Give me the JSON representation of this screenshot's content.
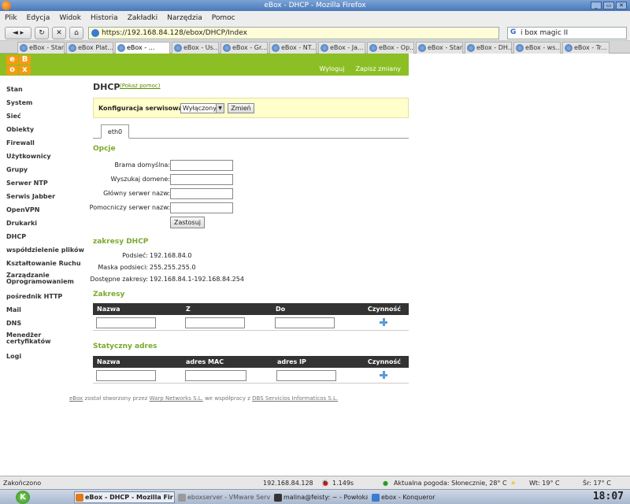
{
  "window": {
    "title": "eBox - DHCP - Mozilla Firefox"
  },
  "menubar": [
    "Plik",
    "Edycja",
    "Widok",
    "Historia",
    "Zakładki",
    "Narzędzia",
    "Pomoc"
  ],
  "navbar": {
    "url": "https://192.168.84.128/ebox/DHCP/Index",
    "search_value": "i box magic II"
  },
  "tabs": [
    {
      "label": "eBox - Stan",
      "active": false
    },
    {
      "label": "eBox Plat...",
      "active": false
    },
    {
      "label": "eBox - ...",
      "active": true
    },
    {
      "label": "eBox - Us...",
      "active": false
    },
    {
      "label": "eBox - Gr...",
      "active": false
    },
    {
      "label": "eBox - NT...",
      "active": false
    },
    {
      "label": "eBox - Ja...",
      "active": false
    },
    {
      "label": "eBox - Op...",
      "active": false
    },
    {
      "label": "eBox - Stan",
      "active": false
    },
    {
      "label": "eBox - DH...",
      "active": false
    },
    {
      "label": "eBox - ws...",
      "active": false
    },
    {
      "label": "eBox - Tr...",
      "active": false
    }
  ],
  "header": {
    "logout": "Wyloguj",
    "save": "Zapisz zmiany"
  },
  "sidebar": [
    "Stan",
    "System",
    "Sieć",
    "Obiekty",
    "Firewall",
    "Użytkownicy",
    "Grupy",
    "Serwer NTP",
    "Serwis Jabber",
    "OpenVPN",
    "Drukarki",
    "DHCP",
    "współdzielenie plików",
    "Kształtowanie Ruchu",
    "Zarządzanie Oprogramowaniem",
    "pośrednik HTTP",
    "Mail",
    "DNS",
    "Menedżer certyfikatów",
    "Logi"
  ],
  "main": {
    "title": "DHCP",
    "help_link": "(Pokaż pomoc)",
    "config_label": "Konfiguracja serwisowa:",
    "config_value": "Wyłączony",
    "change_button": "Zmień",
    "iface_tab": "eth0",
    "options_title": "Opcje",
    "fields": [
      {
        "label": "Brama domyślna:",
        "value": ""
      },
      {
        "label": "Wyszukaj domene:",
        "value": ""
      },
      {
        "label": "Główny serwer nazw:",
        "value": ""
      },
      {
        "label": "Pomocniczy serwer nazw:",
        "value": ""
      }
    ],
    "apply_button": "Zastosuj",
    "ranges_title": "zakresy DHCP",
    "info": [
      {
        "label": "Podsieć:",
        "value": "192.168.84.0"
      },
      {
        "label": "Maska podsieci:",
        "value": "255.255.255.0"
      },
      {
        "label": "Dostępne zakresy:",
        "value": "192.168.84.1-192.168.84.254"
      }
    ],
    "zakresy_title": "Zakresy",
    "zakresy_headers": [
      "Nazwa",
      "Z",
      "Do",
      "Czynność"
    ],
    "static_title": "Statyczny adres",
    "static_headers": [
      "Nazwa",
      "adres MAC",
      "adres IP",
      "Czynność"
    ]
  },
  "footer": {
    "ebox": "eBox",
    "text1": " został stworzony przez ",
    "warp": "Warp Networks S.L.",
    "text2": " we współpracy z ",
    "dbs": "DBS Servicios Informaticos S.L."
  },
  "statusbar": {
    "status": "Zakończono",
    "ip": "192.168.84.128",
    "time": "1.149s",
    "weather": "Aktualna pogoda: Słonecznie, 28° C",
    "wt": "Wt: 19° C",
    "sr": "Śr: 17° C"
  },
  "taskbar": {
    "tasks": [
      {
        "label": "eBox - DHCP - Mozilla Fir",
        "active": true
      },
      {
        "label": "eboxserver - VMware Serve",
        "active": false
      },
      {
        "label": "malina@feisty: ~ - Powłoka",
        "active": false
      },
      {
        "label": "ebox - Konqueror",
        "active": false
      }
    ],
    "clock": "18:07"
  },
  "colors": {
    "accent_green": "#8cbf26",
    "section_green": "#7aa92a",
    "logo_orange": "#f39c12"
  }
}
